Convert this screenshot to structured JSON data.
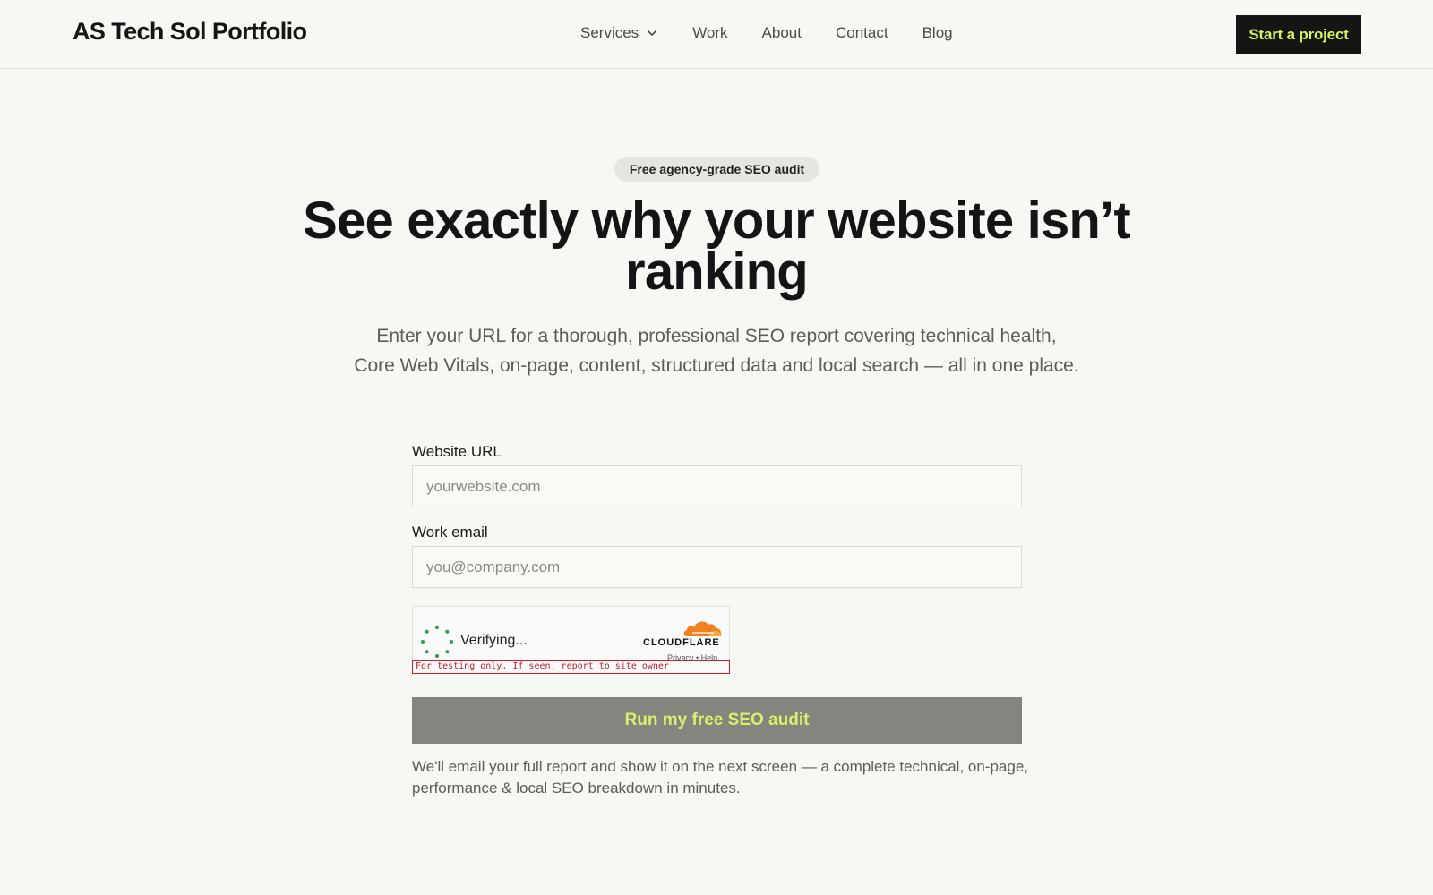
{
  "header": {
    "logo": "AS Tech Sol Portfolio",
    "nav": [
      {
        "label": "Services",
        "has_dropdown": true
      },
      {
        "label": "Work"
      },
      {
        "label": "About"
      },
      {
        "label": "Contact"
      },
      {
        "label": "Blog"
      }
    ],
    "cta_label": "Start a project"
  },
  "hero": {
    "badge": "Free agency-grade SEO audit",
    "headline_line1": "See exactly why your website isn’t",
    "headline_line2": "ranking",
    "subcopy": "Enter your URL for a thorough, professional SEO report covering technical health, Core Web Vitals, on-page, content, structured data and local search — all in one place."
  },
  "form": {
    "url_label": "Website URL",
    "url_placeholder": "yourwebsite.com",
    "url_value": "",
    "email_label": "Work email",
    "email_placeholder": "you@company.com",
    "email_value": "",
    "captcha": {
      "status": "Verifying...",
      "brand": "CLOUDFLARE",
      "links": "Privacy • Help",
      "test_note": "For testing only. If seen, report to site owner"
    },
    "submit_label": "Run my free SEO audit",
    "footnote": "We'll email your full report and show it on the next screen — a complete technical, on-page, performance & local SEO breakdown in minutes."
  },
  "colors": {
    "background": "#f7f7f3",
    "cta_bg": "#141613",
    "cta_text": "#d9f15b",
    "submit_bg": "#858580",
    "submit_text": "#d7f16a",
    "cloudflare_orange": "#f38020",
    "spinner_green": "#2e9e4f",
    "test_note_red": "#d0202a"
  },
  "icons": {
    "services_dropdown": "chevron-down-icon",
    "captcha_spinner": "spinner-icon",
    "cloudflare_logo": "cloudflare-cloud-icon"
  }
}
